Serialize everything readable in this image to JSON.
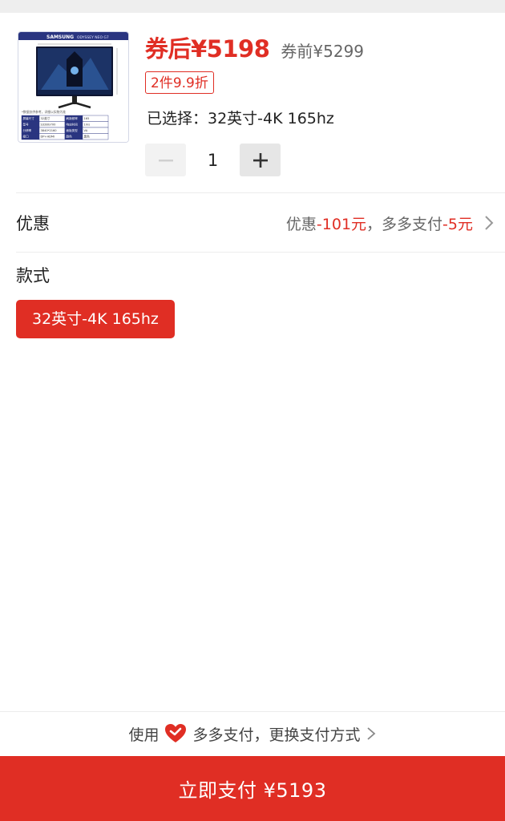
{
  "product": {
    "thumbnail_alt": "monitor-product-image",
    "thumbnail_texts": {
      "brand": "SAMSUNG",
      "model": "ODYSSEY NEO G7",
      "note": "*数据仅供参考，详细以实物为准",
      "specs": [
        [
          "屏幕尺寸",
          "32英寸",
          "刷新频率",
          "165"
        ],
        [
          "型号",
          "S32BG700",
          "响应时间",
          "1ms"
        ],
        [
          "分辨率",
          "3840*2160",
          "面板类型",
          "VA"
        ],
        [
          "接口",
          "DP+HDMI",
          "颜色",
          "黑色"
        ]
      ]
    },
    "price_after": "券后¥5198",
    "price_before": "券前¥5299",
    "promo_badge": "2件9.9折",
    "selected_label": "已选择：32英寸-4K 165hz"
  },
  "quantity": {
    "value": "1",
    "minus_icon": "minus-icon",
    "plus_icon": "plus-icon"
  },
  "discount": {
    "label": "优惠",
    "prefix": "优惠",
    "coupon_amount": "-101元",
    "middle": "，多多支付",
    "pay_amount": "-5元"
  },
  "style": {
    "title": "款式",
    "options": [
      "32英寸-4K 165hz"
    ]
  },
  "payment": {
    "use_prefix": "使用",
    "method_text": "多多支付，更换支付方式",
    "heart_icon": "heart-icon",
    "chevron_icon": "chevron-right-icon",
    "button_label": "立即支付 ¥5193"
  },
  "colors": {
    "accent": "#e02e24",
    "muted_text": "#666666",
    "text": "#222222"
  }
}
